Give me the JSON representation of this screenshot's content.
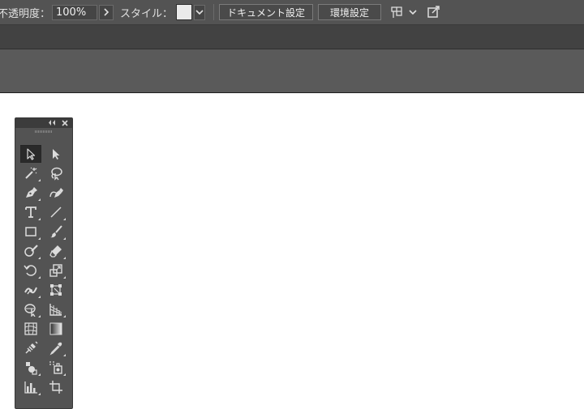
{
  "control_bar": {
    "opacity_label": "不透明度：",
    "opacity_value": "100%",
    "style_label": "スタイル：",
    "document_setup_button": "ドキュメント設定",
    "preferences_button": "環境設定"
  },
  "tools_panel": {
    "tools": [
      {
        "name": "selection-tool-icon",
        "active": true
      },
      {
        "name": "direct-selection-tool-icon"
      },
      {
        "name": "magic-wand-tool-icon"
      },
      {
        "name": "lasso-tool-icon"
      },
      {
        "name": "pen-tool-icon"
      },
      {
        "name": "curvature-tool-icon"
      },
      {
        "name": "type-tool-icon"
      },
      {
        "name": "line-segment-tool-icon"
      },
      {
        "name": "rectangle-tool-icon"
      },
      {
        "name": "paintbrush-tool-icon"
      },
      {
        "name": "shaper-tool-icon"
      },
      {
        "name": "eraser-tool-icon"
      },
      {
        "name": "rotate-tool-icon"
      },
      {
        "name": "scale-tool-icon"
      },
      {
        "name": "width-tool-icon"
      },
      {
        "name": "free-transform-tool-icon"
      },
      {
        "name": "shape-builder-tool-icon"
      },
      {
        "name": "perspective-grid-tool-icon"
      },
      {
        "name": "mesh-tool-icon"
      },
      {
        "name": "gradient-tool-icon"
      },
      {
        "name": "blend-tool-icon"
      },
      {
        "name": "eyedropper-tool-icon"
      },
      {
        "name": "symbol-sprayer-tool-icon"
      },
      {
        "name": "live-paint-bucket-tool-icon"
      },
      {
        "name": "column-graph-tool-icon"
      },
      {
        "name": "artboard-tool-icon"
      }
    ]
  },
  "colors": {
    "control_bar_bg": "#535353",
    "tab_bar_bg": "#424242",
    "canvas_bg": "#ffffff",
    "panel_bg": "#535353",
    "icon_color": "#dcdcdc"
  }
}
